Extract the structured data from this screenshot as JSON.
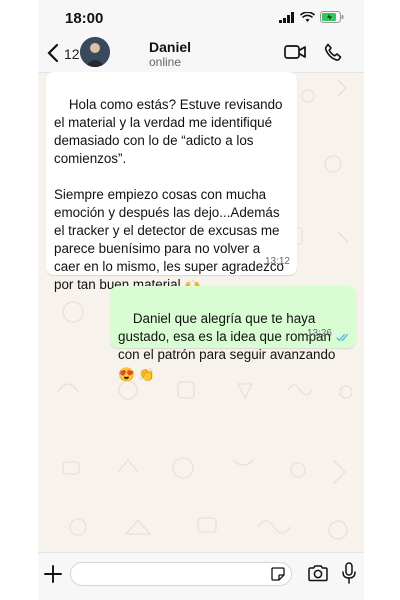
{
  "status_bar": {
    "time": "18:00"
  },
  "header": {
    "unread_count": "12",
    "contact_name": "Daniel",
    "contact_status": "online"
  },
  "messages": [
    {
      "direction": "incoming",
      "text": "Hola como estás? Estuve revisando el material y la verdad me identifiqué demasiado con lo de “adicto a los comienzos”.\n\nSiempre empiezo cosas con mucha emoción y después las dejo...Además el tracker y el detector de excusas me parece buenísimo para no volver a caer en lo mismo, les super agradezco por tan buen material",
      "emoji": "🙌",
      "time": "13:12"
    },
    {
      "direction": "outgoing",
      "text": "Daniel que alegría que te haya gustado, esa es la idea que rompan con el patrón para seguir avanzando",
      "emoji": "😍 👏",
      "time": "13:26",
      "read": true
    }
  ],
  "composer": {
    "value": "",
    "placeholder": ""
  },
  "colors": {
    "incoming_bubble": "#ffffff",
    "outgoing_bubble": "#d9fdd3",
    "read_ticks": "#53bdeb",
    "chat_background": "#f7f3ec"
  },
  "icons": [
    "back-arrow-icon",
    "avatar",
    "video-call-icon",
    "phone-call-icon",
    "plus-icon",
    "sticker-icon",
    "camera-icon",
    "microphone-icon",
    "signal-icon",
    "wifi-icon",
    "battery-icon",
    "double-check-icon"
  ]
}
